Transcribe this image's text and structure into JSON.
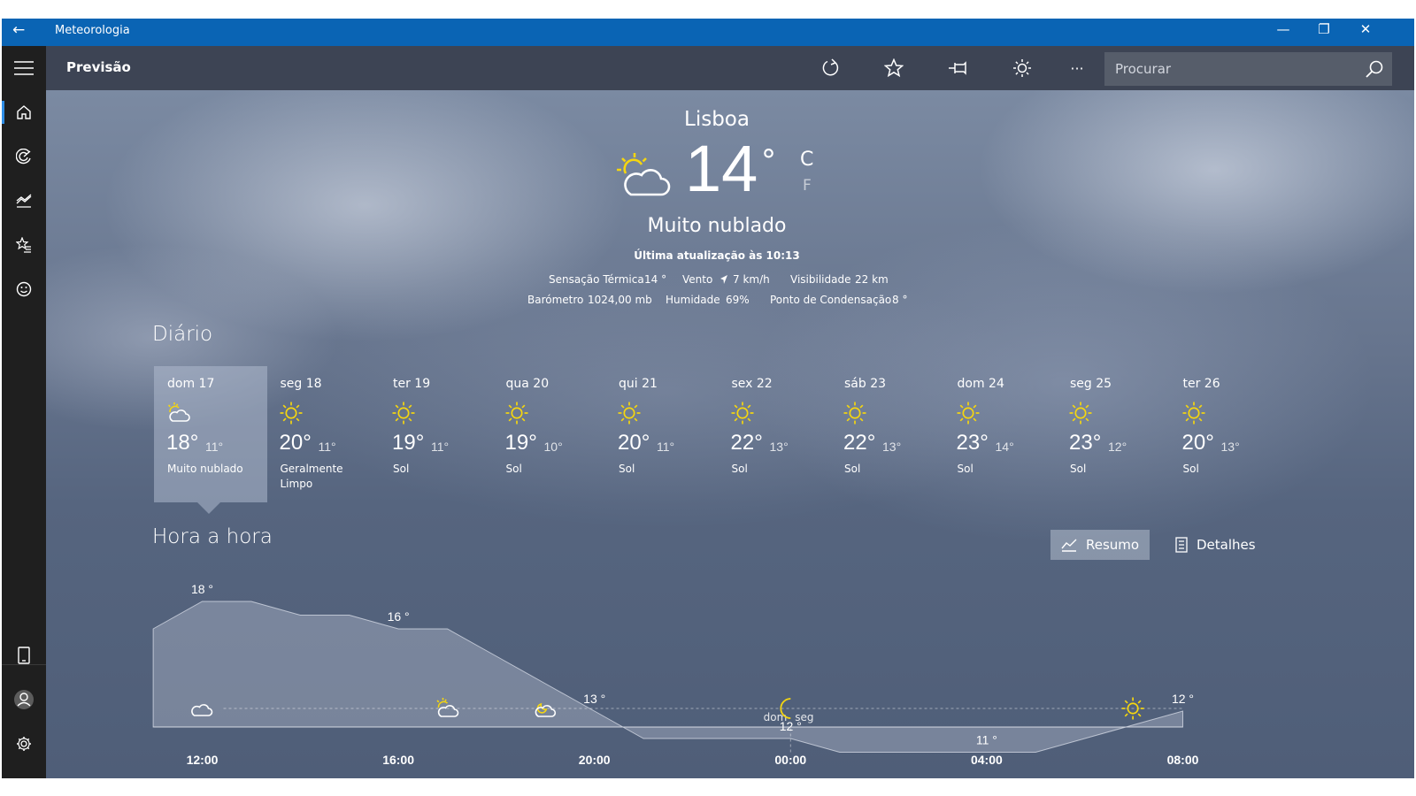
{
  "window": {
    "title": "Meteorologia",
    "back_glyph": "←",
    "minimize_glyph": "—",
    "restore_glyph": "❐",
    "close_glyph": "✕"
  },
  "toolbar": {
    "title": "Previsão",
    "search_placeholder": "Procurar",
    "more_glyph": "···"
  },
  "sidebar": {
    "items": [
      {
        "icon": "home-icon",
        "active": true
      },
      {
        "icon": "radar-icon",
        "active": false
      },
      {
        "icon": "historical-chart-icon",
        "active": false
      },
      {
        "icon": "favorites-list-icon",
        "active": false
      },
      {
        "icon": "smiley-icon",
        "active": false
      }
    ],
    "bottom": [
      "phone-icon",
      "account-icon",
      "settings-icon"
    ]
  },
  "current": {
    "city": "Lisboa",
    "temp": "14",
    "degree": "°",
    "unit_c": "C",
    "unit_f": "F",
    "condition": "Muito nublado",
    "updated": "Última atualização às 10:13",
    "feels_label": "Sensação Térmica",
    "feels_value": "14 °",
    "wind_label": "Vento",
    "wind_value": "7 km/h",
    "visibility_label": "Visibilidade",
    "visibility_value": "22 km",
    "barometer_label": "Barómetro",
    "barometer_value": "1024,00 mb",
    "humidity_label": "Humidade",
    "humidity_value": "69%",
    "dew_label": "Ponto de Condensação",
    "dew_value": "8 °"
  },
  "daily": {
    "title": "Diário",
    "days": [
      {
        "name": "dom 17",
        "hi": "18°",
        "lo": "11°",
        "cond": "Muito nublado",
        "icon": "partly-cloudy"
      },
      {
        "name": "seg 18",
        "hi": "20°",
        "lo": "11°",
        "cond": "Geralmente Limpo",
        "icon": "sun"
      },
      {
        "name": "ter 19",
        "hi": "19°",
        "lo": "11°",
        "cond": "Sol",
        "icon": "sun"
      },
      {
        "name": "qua 20",
        "hi": "19°",
        "lo": "10°",
        "cond": "Sol",
        "icon": "sun"
      },
      {
        "name": "qui 21",
        "hi": "20°",
        "lo": "11°",
        "cond": "Sol",
        "icon": "sun"
      },
      {
        "name": "sex 22",
        "hi": "22°",
        "lo": "13°",
        "cond": "Sol",
        "icon": "sun"
      },
      {
        "name": "sáb 23",
        "hi": "22°",
        "lo": "13°",
        "cond": "Sol",
        "icon": "sun"
      },
      {
        "name": "dom 24",
        "hi": "23°",
        "lo": "14°",
        "cond": "Sol",
        "icon": "sun"
      },
      {
        "name": "seg 25",
        "hi": "23°",
        "lo": "12°",
        "cond": "Sol",
        "icon": "sun"
      },
      {
        "name": "ter 26",
        "hi": "20°",
        "lo": "13°",
        "cond": "Sol",
        "icon": "sun"
      }
    ]
  },
  "hourly": {
    "title": "Hora a hora",
    "summary_label": "Resumo",
    "details_label": "Detalhes",
    "day_before": "dom",
    "day_after": "seg"
  },
  "chart_data": {
    "type": "area",
    "x_tick_labels": [
      "12:00",
      "16:00",
      "20:00",
      "00:00",
      "04:00",
      "08:00"
    ],
    "x_hours": [
      11,
      12,
      13,
      14,
      15,
      16,
      17,
      18,
      19,
      20,
      21,
      22,
      23,
      24,
      25,
      26,
      27,
      28,
      29,
      30,
      31,
      32
    ],
    "temps": [
      17,
      18,
      18,
      17.5,
      17.5,
      17,
      17,
      16,
      15,
      14,
      13,
      13,
      13,
      13,
      12.5,
      12.5,
      12.5,
      12.5,
      12.5,
      13,
      13.5,
      14
    ],
    "ylim": [
      10,
      19
    ],
    "labels": [
      {
        "hour": 12,
        "text": "18 °"
      },
      {
        "hour": 16,
        "text": "16 °"
      },
      {
        "hour": 20,
        "text": "13 °"
      },
      {
        "hour": 24,
        "text": "12 °"
      },
      {
        "hour": 28,
        "text": "11 °"
      },
      {
        "hour": 32,
        "text": "12 °"
      }
    ],
    "icons": [
      {
        "hour": 12,
        "icon": "cloud"
      },
      {
        "hour": 17,
        "icon": "partly-cloudy"
      },
      {
        "hour": 19,
        "icon": "cloud-moon"
      },
      {
        "hour": 24,
        "icon": "moon"
      },
      {
        "hour": 31,
        "icon": "sun"
      }
    ],
    "day_change_hour": 24
  }
}
